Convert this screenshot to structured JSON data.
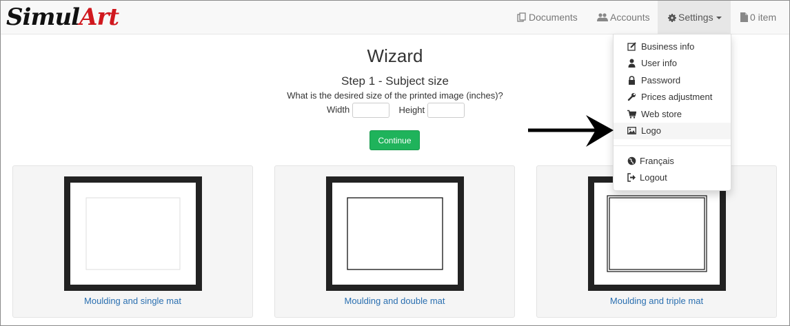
{
  "brand": {
    "part1": "Simul",
    "part2": "Art"
  },
  "nav": {
    "documents": "Documents",
    "accounts": "Accounts",
    "settings": "Settings",
    "cart": "0 item"
  },
  "settings_menu": {
    "items": [
      {
        "label": "Business info",
        "icon": "edit-icon"
      },
      {
        "label": "User info",
        "icon": "user-icon"
      },
      {
        "label": "Password",
        "icon": "lock-icon"
      },
      {
        "label": "Prices adjustment",
        "icon": "wrench-icon"
      },
      {
        "label": "Web store",
        "icon": "shopping-cart-icon"
      },
      {
        "label": "Logo",
        "icon": "picture-icon"
      },
      {
        "label": "Français",
        "icon": "globe-icon"
      },
      {
        "label": "Logout",
        "icon": "logout-icon"
      }
    ]
  },
  "main": {
    "title": "Wizard",
    "step": "Step 1 - Subject size",
    "question": "What is the desired size of the printed image (inches)?",
    "width_label": "Width",
    "width_value": "",
    "height_label": "Height",
    "height_value": "",
    "continue": "Continue"
  },
  "options": [
    {
      "caption": "Moulding and single mat"
    },
    {
      "caption": "Moulding and double mat"
    },
    {
      "caption": "Moulding and triple mat"
    }
  ],
  "colors": {
    "brand_red": "#d0181e",
    "button_green": "#1fb35b",
    "link_blue": "#2a6fb0"
  }
}
